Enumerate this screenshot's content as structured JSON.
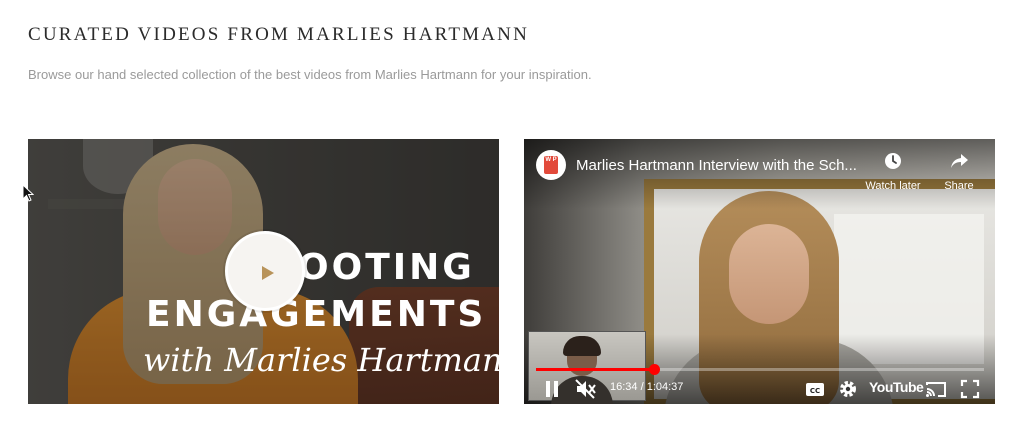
{
  "page": {
    "title": "CURATED VIDEOS FROM MARLIES HARTMANN",
    "subtitle": "Browse our hand selected collection of the best videos from Marlies Hartmann for your inspiration."
  },
  "video1": {
    "thumbnail_text_line1": "OOTING",
    "thumbnail_text_line2": "ENGAGEMENTS",
    "thumbnail_text_line3": "with Marlies Hartmann",
    "play_icon": "play-icon",
    "colors": {
      "play_circle": "#f6f4f1",
      "play_triangle": "#b8935a"
    }
  },
  "video2": {
    "channel_logo_text": "W P",
    "title": "Marlies Hartmann Interview with the Sch...",
    "watch_later_label": "Watch later",
    "share_label": "Share",
    "time_current": "16:34",
    "time_total": "1:04:37",
    "time_display": "16:34 / 1:04:37",
    "progress": 0.265,
    "brand": "YouTube",
    "icons": [
      "pause-icon",
      "mute-icon",
      "cc-icon",
      "settings-icon",
      "cast-icon",
      "fullscreen-icon",
      "clock-icon",
      "share-arrow-icon"
    ],
    "colors": {
      "progress": "#ff0000"
    }
  }
}
